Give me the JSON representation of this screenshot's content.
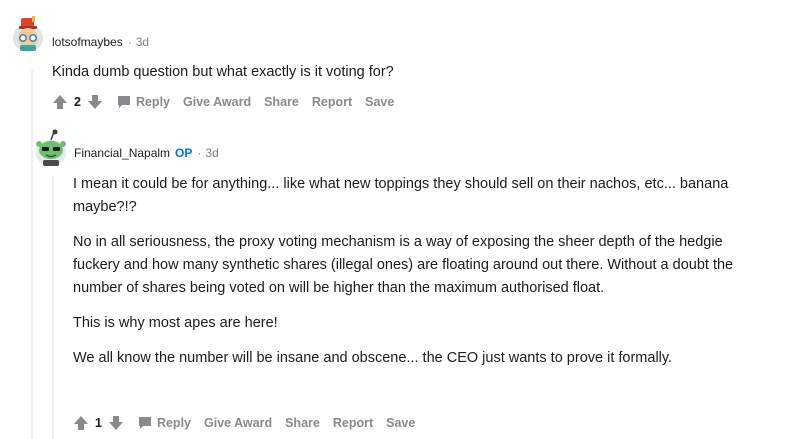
{
  "comment1": {
    "author": "lotsofmaybes",
    "separator": "·",
    "time": "3d",
    "text": "Kinda dumb question but what exactly is it voting for?",
    "score": "2",
    "actions": {
      "reply": "Reply",
      "give_award": "Give Award",
      "share": "Share",
      "report": "Report",
      "save": "Save"
    }
  },
  "comment2": {
    "author": "Financial_Napalm",
    "op_badge": "OP",
    "separator": "·",
    "time": "3d",
    "paragraphs": [
      "I mean it could be for anything... like what new toppings they should sell on their nachos, etc... banana maybe?!?",
      "No in all seriousness, the proxy voting mechanism is a way of exposing the sheer depth of the hedgie fuckery and how many synthetic shares (illegal ones) are floating around out there. Without a doubt the number of shares being voted on will be higher than the maximum authorised float.",
      "This is why most apes are here!",
      "We all know the number will be insane and obscene... the CEO just wants to prove it formally."
    ],
    "score": "1",
    "actions": {
      "reply": "Reply",
      "give_award": "Give Award",
      "share": "Share",
      "report": "Report",
      "save": "Save"
    }
  },
  "colors": {
    "op_blue": "#0079d3",
    "meta_gray": "#7c7c7c",
    "action_gray": "#878a8c",
    "thread_line": "#edeff1"
  },
  "icons": [
    "upvote-icon",
    "downvote-icon",
    "reply-icon",
    "avatar-lotsofmaybes",
    "avatar-financial-napalm"
  ]
}
